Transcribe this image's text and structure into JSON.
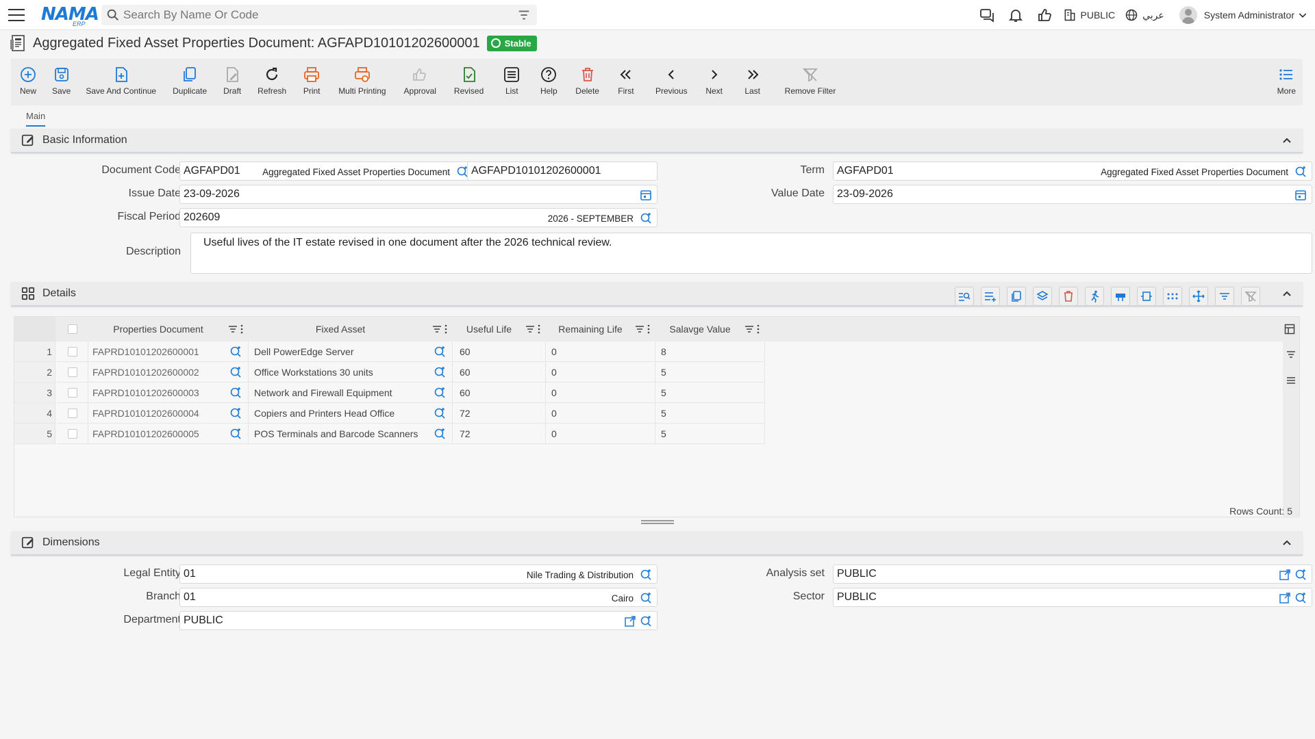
{
  "app": {
    "logo": "NAMA",
    "logo_sub": "ERP",
    "search_placeholder": "Search By Name Or Code",
    "company": "PUBLIC",
    "language": "عربي",
    "user": "System Administrator"
  },
  "page": {
    "title": "Aggregated Fixed Asset Properties Document: AGFAPD10101202600001",
    "status": "Stable"
  },
  "toolbar": {
    "new": "New",
    "save": "Save",
    "save_continue": "Save And Continue",
    "duplicate": "Duplicate",
    "draft": "Draft",
    "refresh": "Refresh",
    "print": "Print",
    "multi_print": "Multi Printing",
    "approval": "Approval",
    "revised": "Revised",
    "list": "List",
    "help": "Help",
    "delete": "Delete",
    "first": "First",
    "previous": "Previous",
    "next": "Next",
    "last": "Last",
    "remove_filter": "Remove Filter",
    "more": "More"
  },
  "tabs": {
    "main": "Main"
  },
  "basic": {
    "title": "Basic Information",
    "doc_code_label": "Document Code",
    "doc_code": "AGFAPD01",
    "doc_code_name": "Aggregated Fixed Asset Properties Document",
    "doc_number": "AGFAPD10101202600001",
    "term_label": "Term",
    "term": "AGFAPD01",
    "term_name": "Aggregated Fixed Asset Properties Document",
    "issue_date_label": "Issue Date",
    "issue_date": "23-09-2026",
    "value_date_label": "Value Date",
    "value_date": "23-09-2026",
    "fiscal_period_label": "Fiscal Period",
    "fiscal_period": "202609",
    "fiscal_period_name": "2026 - SEPTEMBER",
    "description_label": "Description",
    "description": "Useful lives of the IT estate revised in one document after the 2026 technical review."
  },
  "details": {
    "title": "Details",
    "columns": [
      "Properties Document",
      "Fixed Asset",
      "Useful Life",
      "Remaining Life",
      "Salavge Value"
    ],
    "rows": [
      {
        "n": "1",
        "doc": "FAPRD10101202600001",
        "asset": "Dell PowerEdge Server",
        "life": "60",
        "remaining": "0",
        "salvage": "8"
      },
      {
        "n": "2",
        "doc": "FAPRD10101202600002",
        "asset": "Office Workstations 30 units",
        "life": "60",
        "remaining": "0",
        "salvage": "5"
      },
      {
        "n": "3",
        "doc": "FAPRD10101202600003",
        "asset": "Network and Firewall Equipment",
        "life": "60",
        "remaining": "0",
        "salvage": "5"
      },
      {
        "n": "4",
        "doc": "FAPRD10101202600004",
        "asset": "Copiers and Printers Head Office",
        "life": "72",
        "remaining": "0",
        "salvage": "5"
      },
      {
        "n": "5",
        "doc": "FAPRD10101202600005",
        "asset": "POS Terminals and Barcode Scanners",
        "life": "72",
        "remaining": "0",
        "salvage": "5"
      }
    ],
    "rows_count": "Rows Count: 5"
  },
  "dimensions": {
    "title": "Dimensions",
    "legal_entity_label": "Legal Entity",
    "legal_entity": "01",
    "legal_entity_name": "Nile Trading & Distribution",
    "branch_label": "Branch",
    "branch": "01",
    "branch_name": "Cairo",
    "department_label": "Department",
    "department": "PUBLIC",
    "analysis_set_label": "Analysis set",
    "analysis_set": "PUBLIC",
    "sector_label": "Sector",
    "sector": "PUBLIC"
  },
  "colors": {
    "accent": "#1f7ad6",
    "status_green": "#28a745",
    "print_orange": "#e8641f",
    "delete_red": "#d9534f",
    "revised_green": "#2e7d32"
  }
}
